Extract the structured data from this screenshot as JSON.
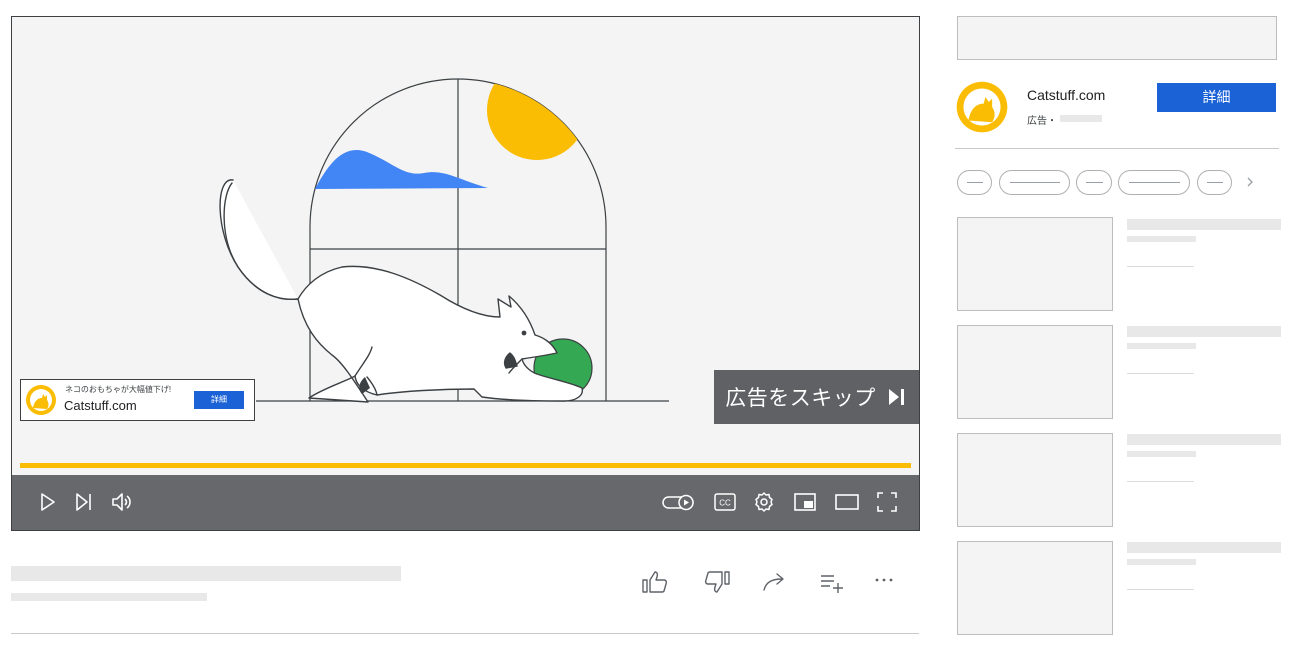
{
  "ad_overlay": {
    "tagline": "ネコのおもちゃが大幅値下げ!",
    "site": "Catstuff.com",
    "cta": "詳細"
  },
  "skip_ad": {
    "label": "広告をスキップ"
  },
  "player_controls": {
    "left": [
      "play-icon",
      "next-icon",
      "volume-icon"
    ],
    "right": [
      "autoplay-toggle-icon",
      "cc-icon",
      "settings-gear-icon",
      "miniplayer-icon",
      "theater-mode-icon",
      "fullscreen-icon"
    ],
    "cc_label": "CC",
    "progress_color": "#fbbc04"
  },
  "video_actions": [
    "like-icon",
    "dislike-icon",
    "share-icon",
    "save-to-playlist-icon",
    "more-options-icon"
  ],
  "sidebar_ad": {
    "advertiser": "Catstuff.com",
    "label": "広告・",
    "cta": "詳細"
  },
  "colors": {
    "accent_blue": "#1a62d6",
    "logo_yellow": "#fbbc04",
    "sun_yellow": "#fbbc04",
    "cloud_blue": "#4285f4",
    "ball_green": "#34a853",
    "controls_bg": "#66686b"
  }
}
